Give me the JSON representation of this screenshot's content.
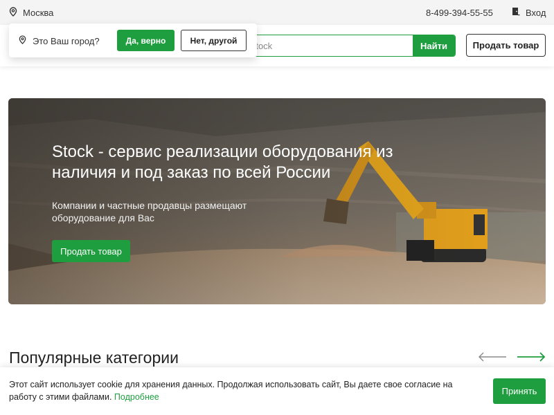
{
  "topbar": {
    "city": "Москва",
    "phone": "8-499-394-55-55",
    "login": "Вход"
  },
  "city_popup": {
    "question": "Это Ваш город?",
    "yes_label": "Да, верно",
    "no_label": "Нет, другой"
  },
  "header": {
    "search_placeholder": "Поиск на Stock",
    "search_button": "Найти",
    "sell_button": "Продать товар"
  },
  "hero": {
    "title": "Stock - сервис реализации оборудования из наличия и под заказ по всей России",
    "subtitle": "Компании и частные продавцы размещают оборудование для Вас",
    "button": "Продать товар"
  },
  "categories": {
    "title": "Популярные категории"
  },
  "cookie": {
    "text": "Этот сайт использует cookie для хранения данных. Продолжая использовать сайт, Вы даете свое согласие на работу с этими файлами.",
    "link": "Подробнее",
    "accept": "Принять"
  },
  "icons": {
    "city": "location-pin-icon",
    "login": "door-icon",
    "prev": "arrow-left-icon",
    "next": "arrow-right-icon"
  },
  "colors": {
    "accent": "#1e9e3f",
    "topbar_bg": "#f4f4f4"
  }
}
